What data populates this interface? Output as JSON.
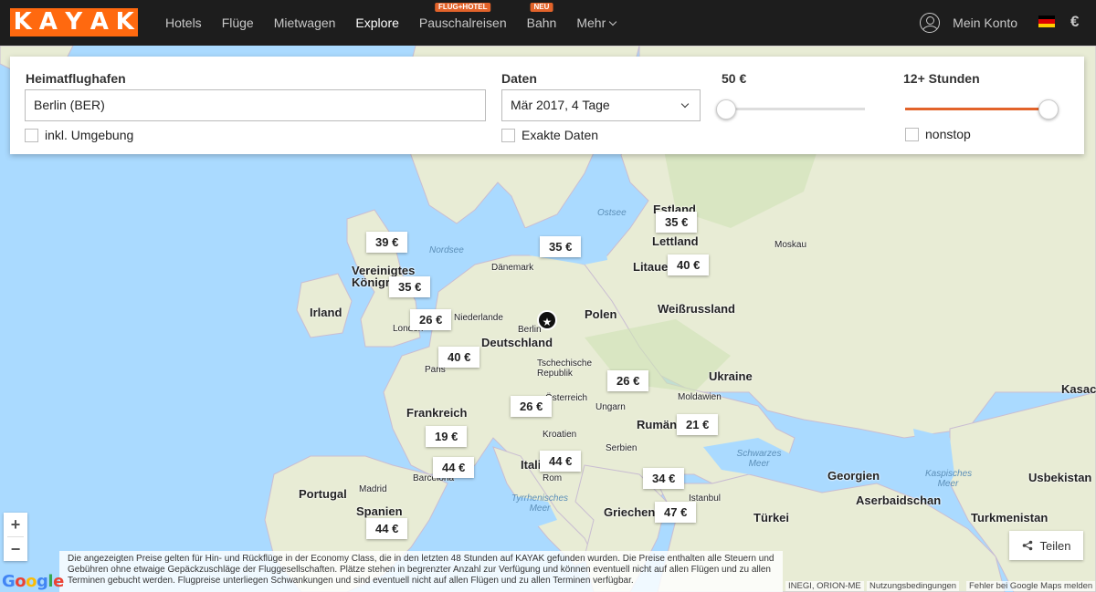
{
  "brand": {
    "letters": [
      "K",
      "A",
      "Y",
      "A",
      "K"
    ]
  },
  "nav": {
    "items": [
      {
        "label": "Hotels"
      },
      {
        "label": "Flüge"
      },
      {
        "label": "Mietwagen"
      },
      {
        "label": "Explore"
      },
      {
        "label": "Pauschalreisen",
        "badge": "FLUG+HOTEL"
      },
      {
        "label": "Bahn",
        "badge": "NEU"
      },
      {
        "label": "Mehr"
      }
    ],
    "account": "Mein Konto",
    "currency": "€",
    "flag_colors": [
      "#000000",
      "#dd0000",
      "#ffce00"
    ]
  },
  "search": {
    "home_airport_label": "Heimatflughafen",
    "home_airport_value": "Berlin (BER)",
    "nearby_label": "inkl. Umgebung",
    "dates_label": "Daten",
    "dates_value": "Mär 2017, 4 Tage",
    "exact_dates_label": "Exakte Daten",
    "price_label": "50 €",
    "price_slider_fraction": 0,
    "duration_label": "12+ Stunden",
    "duration_slider_fraction": 1,
    "nonstop_label": "nonstop"
  },
  "map": {
    "places": [
      {
        "name": "Estland"
      },
      {
        "name": "Lettland"
      },
      {
        "name": "Litauen"
      },
      {
        "name": "Moskau"
      },
      {
        "name": "Dänemark"
      },
      {
        "name": "Vereinigtes Königreich"
      },
      {
        "name": "Irland"
      },
      {
        "name": "London"
      },
      {
        "name": "Niederlande"
      },
      {
        "name": "Berlin"
      },
      {
        "name": "Deutschland"
      },
      {
        "name": "Polen"
      },
      {
        "name": "Weißrussland"
      },
      {
        "name": "Paris"
      },
      {
        "name": "Tschechische Republik"
      },
      {
        "name": "Ukraine"
      },
      {
        "name": "Frankreich"
      },
      {
        "name": "Österreich"
      },
      {
        "name": "Ungarn"
      },
      {
        "name": "Moldawien"
      },
      {
        "name": "Rumänien"
      },
      {
        "name": "Kroatien"
      },
      {
        "name": "Serbien"
      },
      {
        "name": "Italien"
      },
      {
        "name": "Rom"
      },
      {
        "name": "Barcelona"
      },
      {
        "name": "Portugal"
      },
      {
        "name": "Madrid"
      },
      {
        "name": "Spanien"
      },
      {
        "name": "Griechenland"
      },
      {
        "name": "Istanbul"
      },
      {
        "name": "Türkei"
      },
      {
        "name": "Georgien"
      },
      {
        "name": "Aserbaidschan"
      },
      {
        "name": "Turkmenistan"
      },
      {
        "name": "Usbekistan"
      },
      {
        "name": "Kasachstan"
      }
    ],
    "seas": [
      {
        "name": "Ostsee"
      },
      {
        "name": "Nordsee"
      },
      {
        "name": "Schwarzes Meer"
      },
      {
        "name": "Kaspisches Meer"
      },
      {
        "name": "Tyrrhenisches Meer"
      }
    ],
    "prices": [
      "35 €",
      "39 €",
      "35 €",
      "40 €",
      "35 €",
      "26 €",
      "40 €",
      "26 €",
      "26 €",
      "21 €",
      "19 €",
      "44 €",
      "44 €",
      "34 €",
      "47 €",
      "44 €"
    ],
    "home_marker": "★"
  },
  "controls": {
    "zoom_in": "+",
    "zoom_out": "−",
    "share": "Teilen",
    "google": "Google",
    "terms": "Nutzungsbedingungen",
    "report": "Fehler bei Google Maps melden",
    "credits": "INEGI, ORION-ME"
  },
  "disclaimer": "Die angezeigten Preise gelten für Hin- und Rückflüge in der Economy Class, die in den letzten 48 Stunden auf KAYAK gefunden wurden. Die Preise enthalten alle Steuern und Gebühren ohne etwaige Gepäckzuschläge der Fluggesellschaften. Plätze stehen in begrenzter Anzahl zur Verfügung und können eventuell nicht auf allen Flügen und zu allen Terminen gebucht werden. Flugpreise unterliegen Schwankungen und sind eventuell nicht auf allen Flügen und zu allen Terminen verfügbar."
}
